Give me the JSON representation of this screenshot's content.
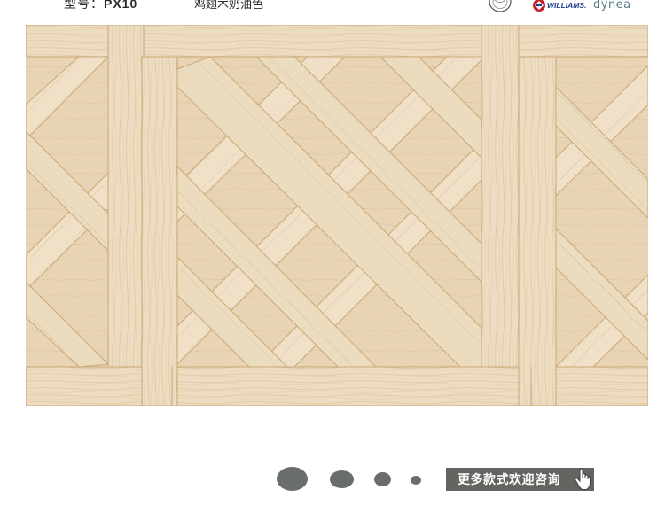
{
  "header": {
    "model_label": "型号：",
    "model_value": "PX10",
    "color_name": "鸡翅木奶油色",
    "brands": [
      {
        "name": "seal-logo"
      },
      {
        "name": "WILLIAMS.",
        "icon": "williams-logo"
      },
      {
        "name": "dynea"
      }
    ]
  },
  "product_image": {
    "pattern": "versailles-parquet",
    "icon": "parquet-floor-image"
  },
  "carousel": {
    "slide_count": 4,
    "active_index": 0
  },
  "consult_button": {
    "label": "更多款式欢迎咨询",
    "icon": "hand-pointer-icon"
  },
  "colors": {
    "wood_light": "#efe1c9",
    "wood_mid": "#e6d2b2",
    "wood_seam": "#c9a874",
    "dot": "#6a6e6a",
    "button_bg": "#61645f",
    "dynea": "#5a7f8c"
  }
}
